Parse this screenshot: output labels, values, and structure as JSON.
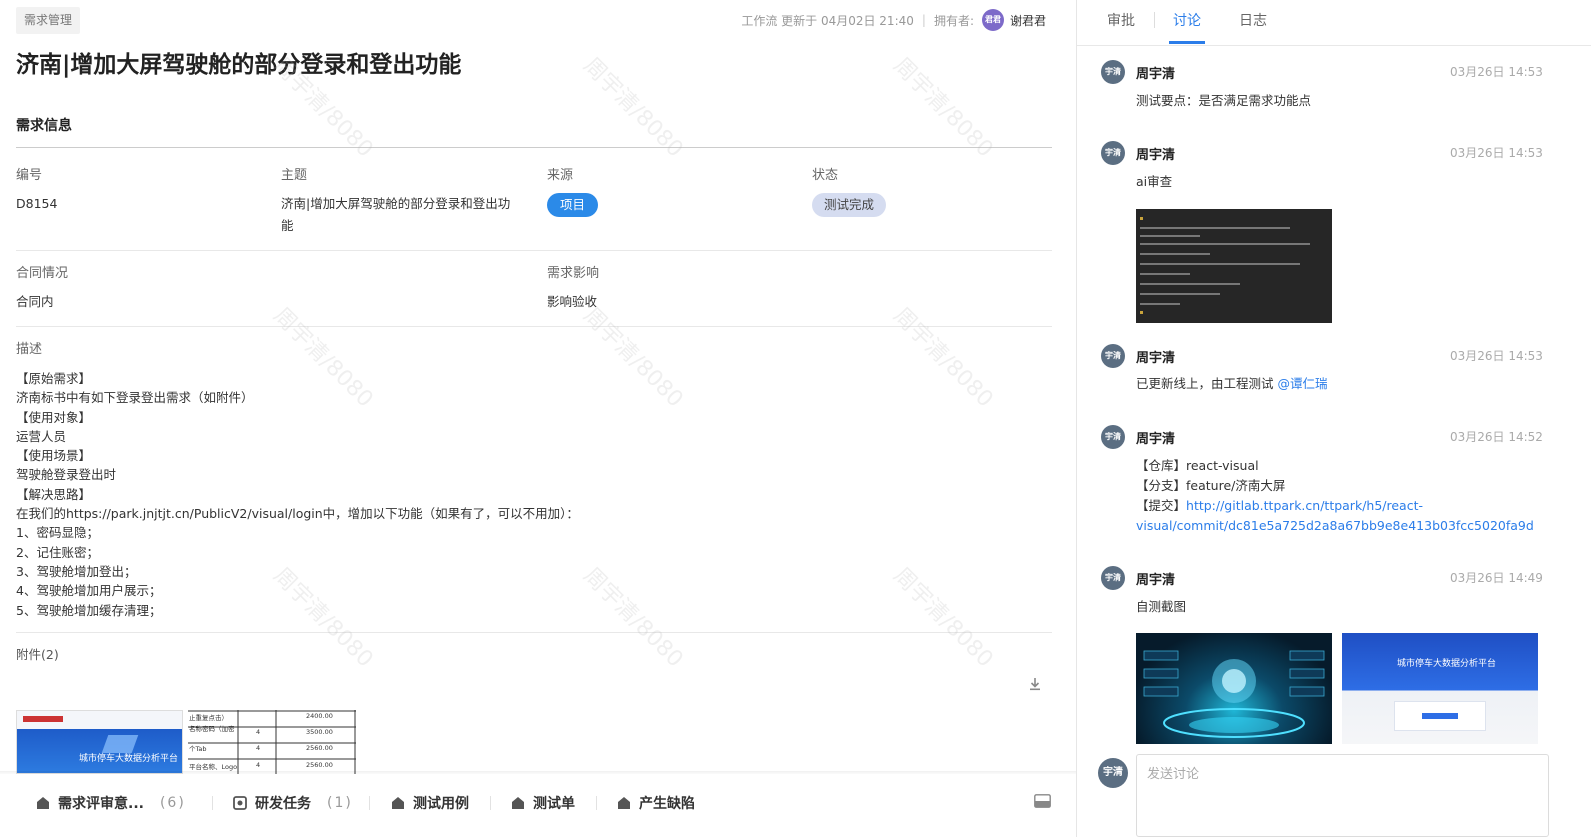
{
  "header": {
    "tag": "需求管理",
    "updated": "工作流 更新于 04月02日 21:40",
    "owner_label": "拥有者:",
    "owner_avatar": "君君",
    "owner_name": "谢君君"
  },
  "title": "济南|增加大屏驾驶舱的部分登录和登出功能",
  "info": {
    "section_title": "需求信息",
    "id_label": "编号",
    "id_value": "D8154",
    "subject_label": "主题",
    "subject_line1": "济南|增加大屏驾驶舱的部分登录和登出功",
    "subject_line2": "能",
    "source_label": "来源",
    "source_value": "项目",
    "status_label": "状态",
    "status_value": "测试完成",
    "contract_label": "合同情况",
    "contract_value": "合同内",
    "impact_label": "需求影响",
    "impact_value": "影响验收"
  },
  "description": {
    "label": "描述",
    "lines": [
      "【原始需求】",
      "济南标书中有如下登录登出需求（如附件）",
      "【使用对象】",
      "运营人员",
      "【使用场景】",
      "驾驶舱登录登出时",
      "【解决思路】",
      "在我们的https://park.jnjtjt.cn/PublicV2/visual/login中，增加以下功能（如果有了，可以不用加）：",
      "1、密码显隐；",
      "2、记住账密；",
      "3、驾驶舱增加登出；",
      "4、驾驶舱增加用户展示；",
      "5、驾驶舱增加缓存清理；"
    ]
  },
  "attachments": {
    "label": "附件(2)",
    "thumb1_title": "城市停车大数据分析平台",
    "thumb2_rows": [
      {
        "name": "止重复点击）",
        "qty": "",
        "price": "2400.00"
      },
      {
        "name": "名称密码（加密",
        "qty": "4",
        "price": "3500.00"
      },
      {
        "name": "个Tab",
        "qty": "4",
        "price": "2560.00"
      },
      {
        "name": "平台名称、Logo",
        "qty": "4",
        "price": "2560.00"
      }
    ]
  },
  "bottom_tabs": [
    {
      "label": "需求评审意...",
      "count": "(6)"
    },
    {
      "label": "研发任务",
      "count": "(1)"
    },
    {
      "label": "测试用例",
      "count": ""
    },
    {
      "label": "测试单",
      "count": ""
    },
    {
      "label": "产生缺陷",
      "count": ""
    }
  ],
  "side": {
    "tabs": [
      "审批",
      "讨论",
      "日志"
    ],
    "active_tab": "讨论",
    "comments": [
      {
        "avatar": "宇清",
        "name": "周宇清",
        "time": "03月26日 14:53",
        "lines": [
          "测试要点：是否满足需求功能点"
        ]
      },
      {
        "avatar": "宇清",
        "name": "周宇清",
        "time": "03月26日 14:53",
        "lines": [
          "ai审查"
        ]
      },
      {
        "avatar": "宇清",
        "name": "周宇清",
        "time": "03月26日 14:53",
        "text": "已更新线上，由工程测试 ",
        "mention": "@谭仁瑞"
      },
      {
        "avatar": "宇清",
        "name": "周宇清",
        "time": "03月26日 14:52",
        "repo": "【仓库】react-visual",
        "branch": "【分支】feature/济南大屏",
        "commit_label": "【提交】",
        "commit_link1": "http://gitlab.ttpark.cn/ttpark/h5/react-",
        "commit_link2": "visual/commit/dc81e5a725d2a8a67bb9e8e413b03fcc5020fa9d"
      },
      {
        "avatar": "宇清",
        "name": "周宇清",
        "time": "03月26日 14:49",
        "lines": [
          "自测截图"
        ]
      }
    ],
    "screenshot_title": "城市停车大数据分析平台",
    "input_avatar": "宇清",
    "input_placeholder": "发送讨论"
  },
  "watermark": "周宇清/8080",
  "colors": {
    "accent": "#2b7de9",
    "source_pill": "#2b8ae8",
    "status_pill": "#d5dcf0",
    "owner_avatar": "#7d6ac9",
    "user_avatar": "#5b6e82"
  }
}
